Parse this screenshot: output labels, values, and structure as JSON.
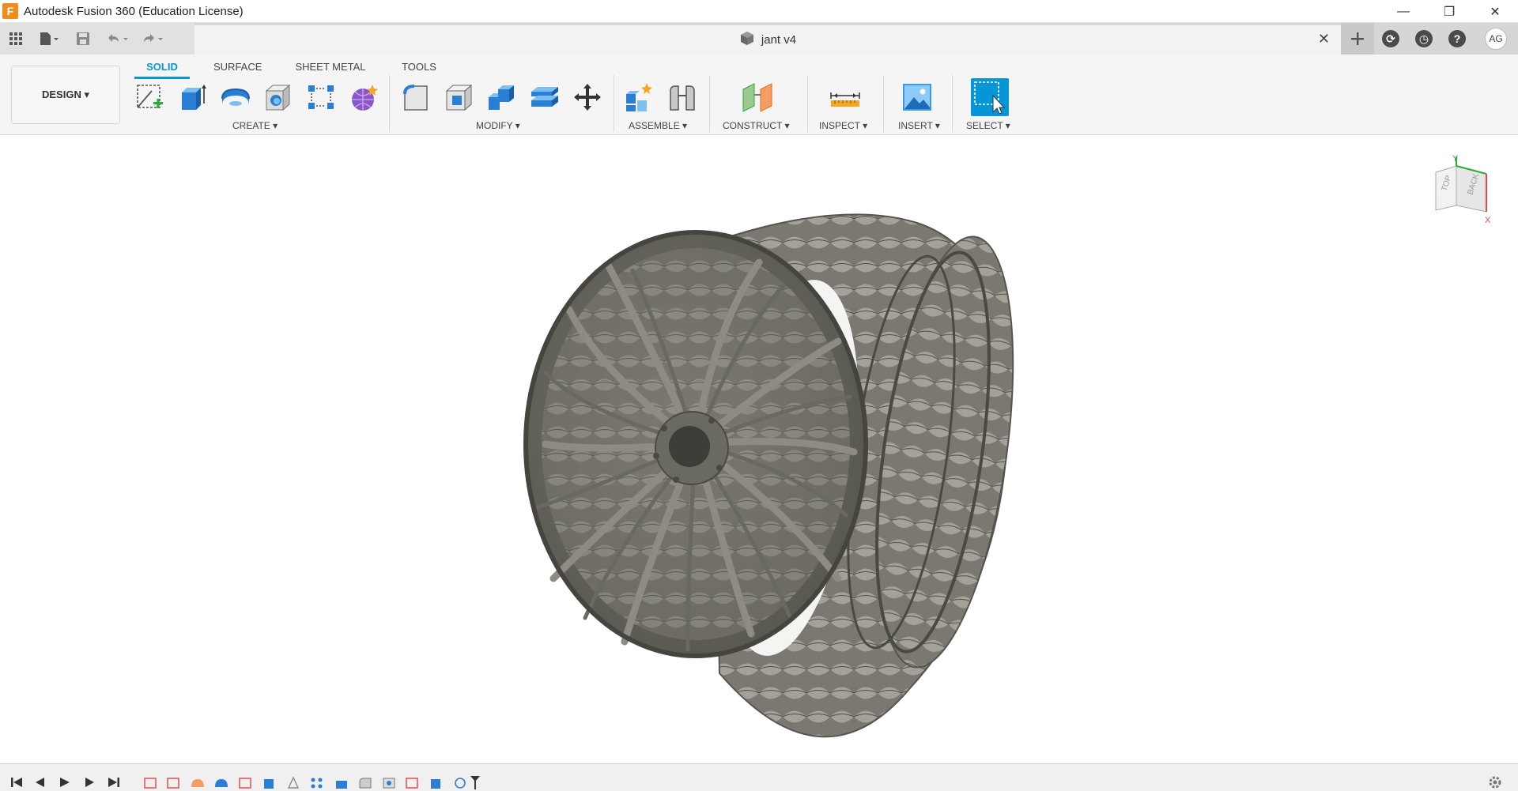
{
  "window": {
    "title": "Autodesk Fusion 360 (Education License)",
    "logo_letter": "F",
    "minimize": "—",
    "restore": "❐",
    "close": "✕"
  },
  "document": {
    "name": "jant v4",
    "close": "✕"
  },
  "user": {
    "initials": "AG"
  },
  "workspace": {
    "label": "DESIGN ▾"
  },
  "tabs": [
    {
      "label": "SOLID",
      "active": true
    },
    {
      "label": "SURFACE"
    },
    {
      "label": "SHEET METAL"
    },
    {
      "label": "TOOLS"
    }
  ],
  "groups": {
    "create": "CREATE ▾",
    "modify": "MODIFY ▾",
    "assemble": "ASSEMBLE ▾",
    "construct": "CONSTRUCT ▾",
    "inspect": "INSPECT ▾",
    "insert": "INSERT ▾",
    "select": "SELECT ▾"
  },
  "viewcube": {
    "top": "TOP",
    "back": "BACK",
    "axis_x": "X",
    "axis_y": "Y"
  },
  "colors": {
    "accent": "#0696d7",
    "ribbon_bg": "#f5f5f5"
  }
}
